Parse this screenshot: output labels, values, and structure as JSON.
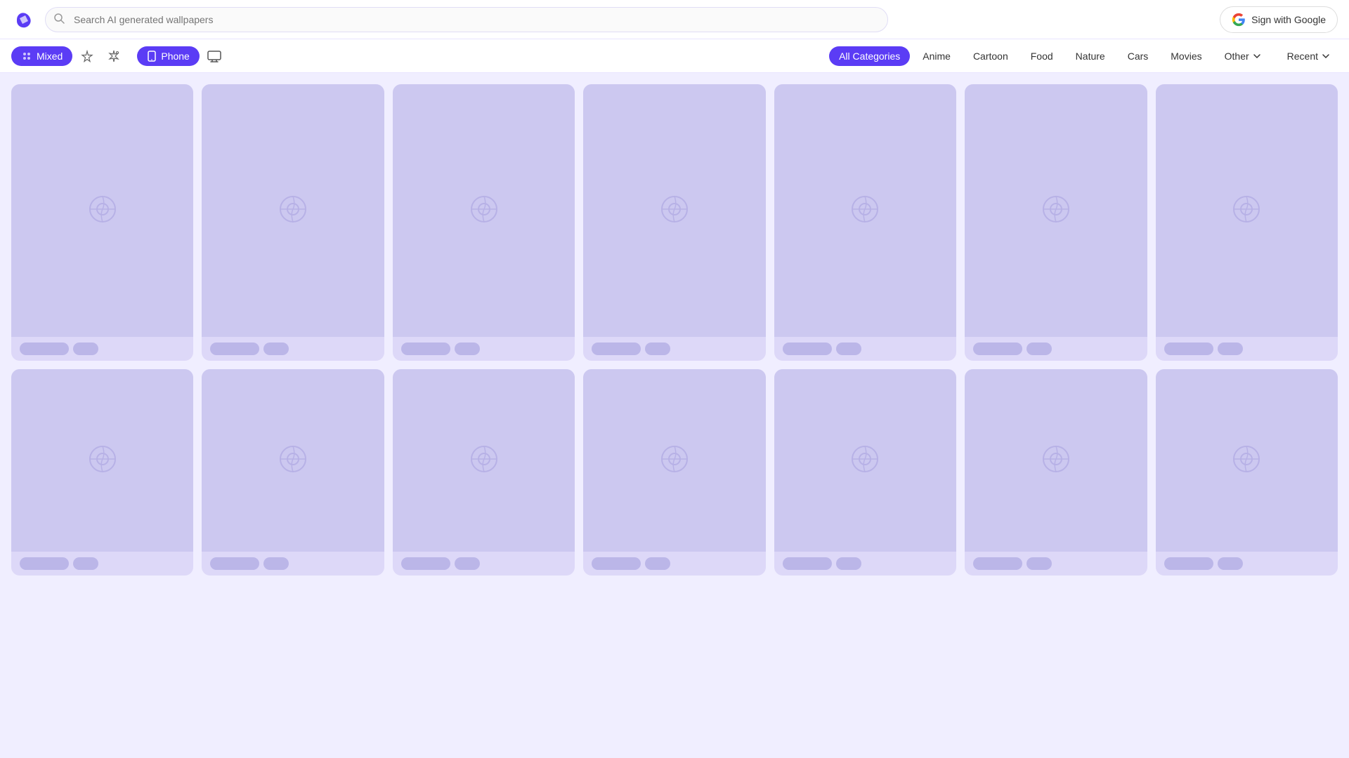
{
  "header": {
    "logo_alt": "App Logo",
    "search_placeholder": "Search AI generated wallpapers",
    "sign_in_label": "Sign with Google"
  },
  "nav": {
    "mixed_label": "Mixed",
    "phone_label": "Phone",
    "categories": [
      {
        "id": "all",
        "label": "All Categories",
        "active": true
      },
      {
        "id": "anime",
        "label": "Anime",
        "active": false
      },
      {
        "id": "cartoon",
        "label": "Cartoon",
        "active": false
      },
      {
        "id": "food",
        "label": "Food",
        "active": false
      },
      {
        "id": "nature",
        "label": "Nature",
        "active": false
      },
      {
        "id": "cars",
        "label": "Cars",
        "active": false
      },
      {
        "id": "movies",
        "label": "Movies",
        "active": false
      },
      {
        "id": "other",
        "label": "Other",
        "active": false
      }
    ],
    "recent_label": "Recent"
  },
  "grid": {
    "loading": true,
    "columns": 7,
    "rows": 2
  },
  "colors": {
    "accent": "#5b3cf5",
    "card_bg": "#ccc8f0",
    "card_icon": "#9990d8",
    "page_bg": "#f0eeff"
  }
}
